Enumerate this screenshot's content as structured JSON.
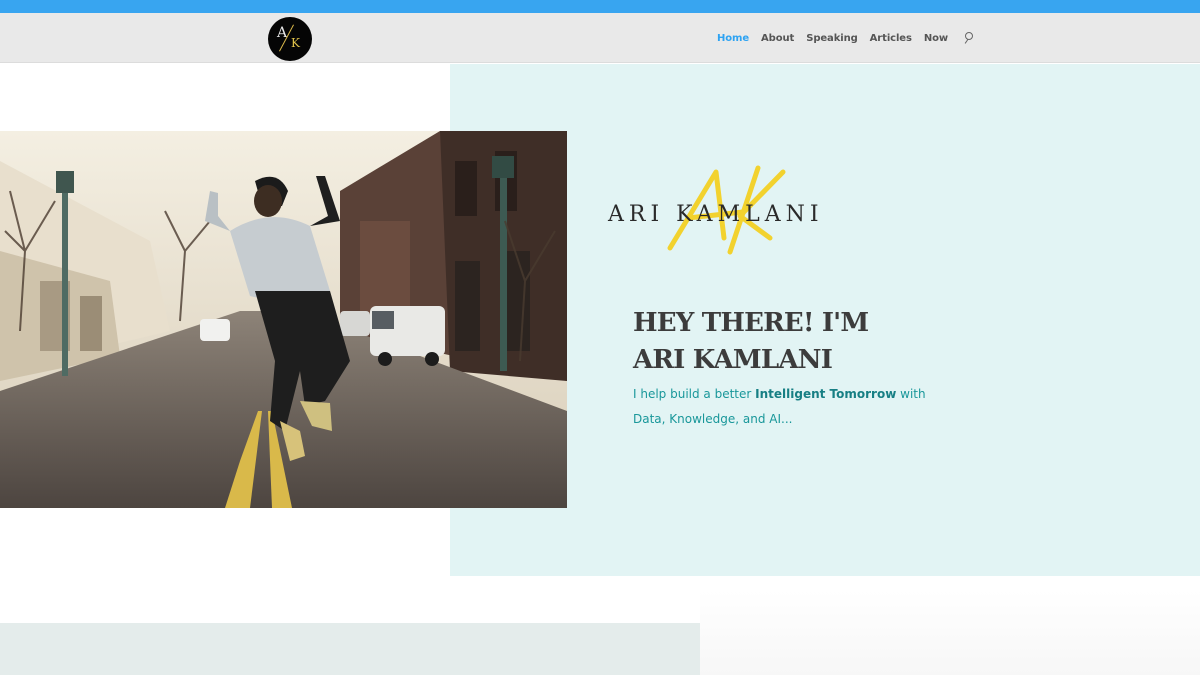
{
  "logo": {
    "initial_left": "A",
    "initial_right": "K"
  },
  "nav": {
    "items": [
      {
        "label": "Home",
        "active": true
      },
      {
        "label": "About",
        "active": false
      },
      {
        "label": "Speaking",
        "active": false
      },
      {
        "label": "Articles",
        "active": false
      },
      {
        "label": "Now",
        "active": false
      }
    ],
    "search_icon": "search-icon"
  },
  "signature": {
    "initials": "AK",
    "name": "ARI KAMLANI"
  },
  "hero": {
    "heading_line1": "HEY THERE!  I'M",
    "heading_line2": "ARI KAMLANI",
    "sub_before": "I help build a better ",
    "sub_bold": "Intelligent Tomorrow",
    "sub_after": " with Data, Knowledge, and AI..."
  },
  "colors": {
    "accent_blue": "#2ea3f2",
    "teal_text": "#19979a",
    "teal_panel": "#e2f4f4",
    "signature_yellow": "#f2d22e"
  }
}
